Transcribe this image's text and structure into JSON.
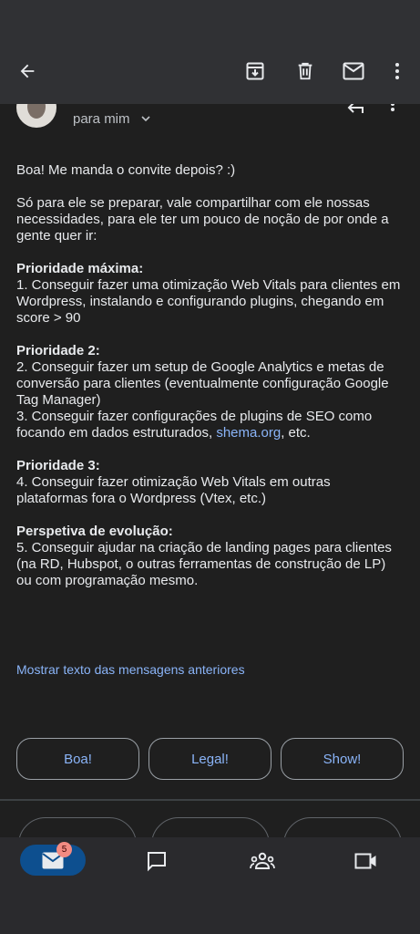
{
  "toolbar": {
    "back_icon": "arrow-left-icon",
    "archive_icon": "archive-icon",
    "delete_icon": "trash-icon",
    "mark_unread_icon": "mail-icon",
    "more_icon": "more-vertical-icon"
  },
  "message": {
    "recipient_label": "para mim",
    "greeting": "Boa! Me manda o convite depois? :)",
    "intro": "Só para ele se preparar, vale compartilhar com ele nossas necessidades, para ele ter um pouco de noção de por onde a gente quer ir:",
    "priority1_title": "Prioridade máxima:",
    "priority1_item": "1. Conseguir fazer uma otimização Web Vitals para clientes em Wordpress, instalando e configurando plugins, chegando em score > 90",
    "priority2_title": "Prioridade 2:",
    "priority2_item1": "2. Conseguir fazer um setup de Google Analytics e metas de conversão para clientes (eventualmente configuração Google Tag Manager)",
    "priority2_item2_before": "3. Conseguir fazer configurações de plugins de SEO como focando em dados estruturados, ",
    "priority2_item2_link": "shema.org",
    "priority2_item2_after": ", etc.",
    "priority3_title": "Prioridade 3:",
    "priority3_item": "4. Conseguir fazer otimização Web Vitals em outras plataformas fora o Wordpress (Vtex, etc.)",
    "evolution_title": "Perspetiva de evolução:",
    "evolution_item": "5. Conseguir ajudar na criação de landing pages para clientes (na RD, Hubspot, o outras ferramentas de construção de LP) ou com programação mesmo.",
    "show_quoted": "Mostrar texto das mensagens anteriores"
  },
  "smart_replies": [
    "Boa!",
    "Legal!",
    "Show!"
  ],
  "bottom_nav": {
    "mail_badge": "5",
    "items": [
      "mail-icon",
      "chat-icon",
      "spaces-icon",
      "meet-icon"
    ]
  },
  "colors": {
    "background": "#1f1f1f",
    "appbar": "#303134",
    "link": "#8ab4f8",
    "active_nav": "#0d4f8f",
    "badge": "#f28b82"
  }
}
